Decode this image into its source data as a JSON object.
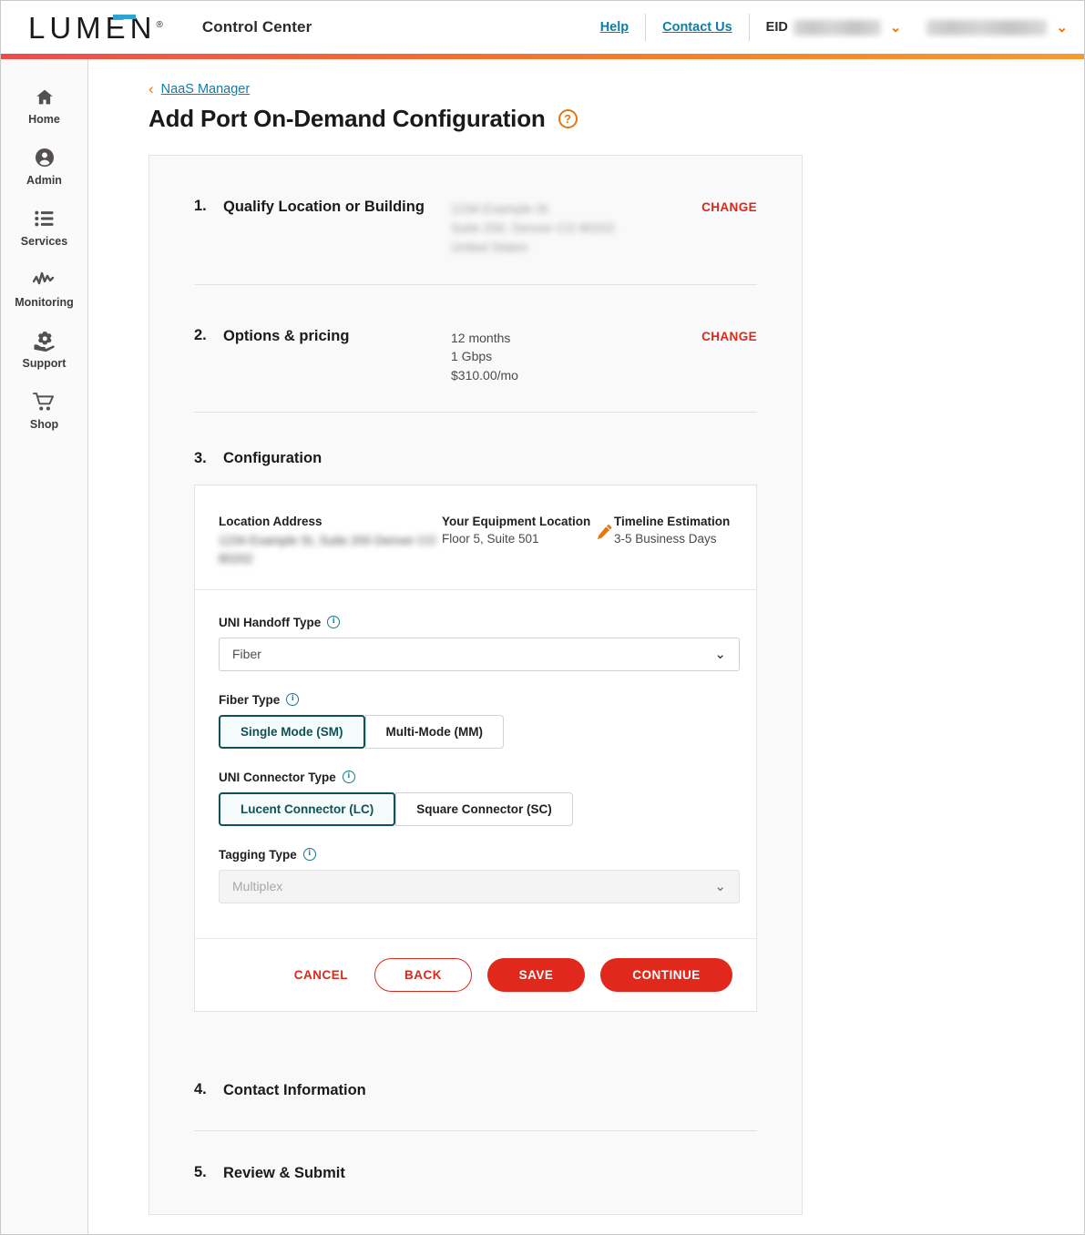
{
  "header": {
    "logo": "LUMEN",
    "logo_registered": "®",
    "app_title": "Control Center",
    "help_label": "Help",
    "contact_label": "Contact Us",
    "eid_label": "EID",
    "eid_value": "",
    "account_value": "",
    "chevron": "⌄"
  },
  "sidebar": {
    "items": [
      {
        "label": "Home",
        "icon": "home-icon"
      },
      {
        "label": "Admin",
        "icon": "user-circle-icon"
      },
      {
        "label": "Services",
        "icon": "list-icon"
      },
      {
        "label": "Monitoring",
        "icon": "activity-icon"
      },
      {
        "label": "Support",
        "icon": "support-hand-icon"
      },
      {
        "label": "Shop",
        "icon": "cart-icon"
      }
    ]
  },
  "breadcrumb": {
    "back_arrow": "‹",
    "link": "NaaS Manager"
  },
  "page": {
    "title": "Add Port On-Demand Configuration",
    "help_icon_glyph": "?"
  },
  "steps": {
    "one": {
      "number": "1.",
      "title": "Qualify Location or Building",
      "address_lines": [
        "1234 Example St",
        "Suite 200, Denver CO 80202",
        "United States"
      ],
      "change_label": "CHANGE"
    },
    "two": {
      "number": "2.",
      "title": "Options & pricing",
      "details": [
        "12 months",
        "1 Gbps",
        "$310.00/mo"
      ],
      "change_label": "CHANGE"
    },
    "three": {
      "number": "3.",
      "title": "Configuration",
      "card": {
        "location_address_label": "Location Address",
        "location_address_lines": [
          "1234 Example St, Suite 200",
          "Denver CO 80202"
        ],
        "equipment_label": "Your Equipment Location",
        "equipment_value": "Floor 5, Suite 501",
        "edit_icon": "pencil-icon",
        "timeline_label": "Timeline Estimation",
        "timeline_value": "3-5 Business Days"
      },
      "fields": {
        "uni_handoff": {
          "label": "UNI Handoff Type",
          "value": "Fiber",
          "chevron": "⌄"
        },
        "fiber_type": {
          "label": "Fiber Type",
          "options": [
            "Single Mode (SM)",
            "Multi-Mode (MM)"
          ],
          "selected": "Single Mode (SM)"
        },
        "uni_connector": {
          "label": "UNI Connector Type",
          "options": [
            "Lucent Connector (LC)",
            "Square Connector (SC)"
          ],
          "selected": "Lucent Connector (LC)"
        },
        "tagging_type": {
          "label": "Tagging Type",
          "value": "Multiplex",
          "disabled": true,
          "chevron": "⌄"
        }
      },
      "actions": {
        "cancel": "CANCEL",
        "back": "BACK",
        "save": "SAVE",
        "continue": "CONTINUE"
      }
    },
    "four": {
      "number": "4.",
      "title": "Contact Information"
    },
    "five": {
      "number": "5.",
      "title": "Review & Submit"
    }
  },
  "colors": {
    "brand_red": "#e0291c",
    "brand_orange": "#e8760e",
    "link_teal": "#0d7ea8",
    "accent_teal": "#0f5156",
    "logo_blue": "#2fa3d4"
  }
}
